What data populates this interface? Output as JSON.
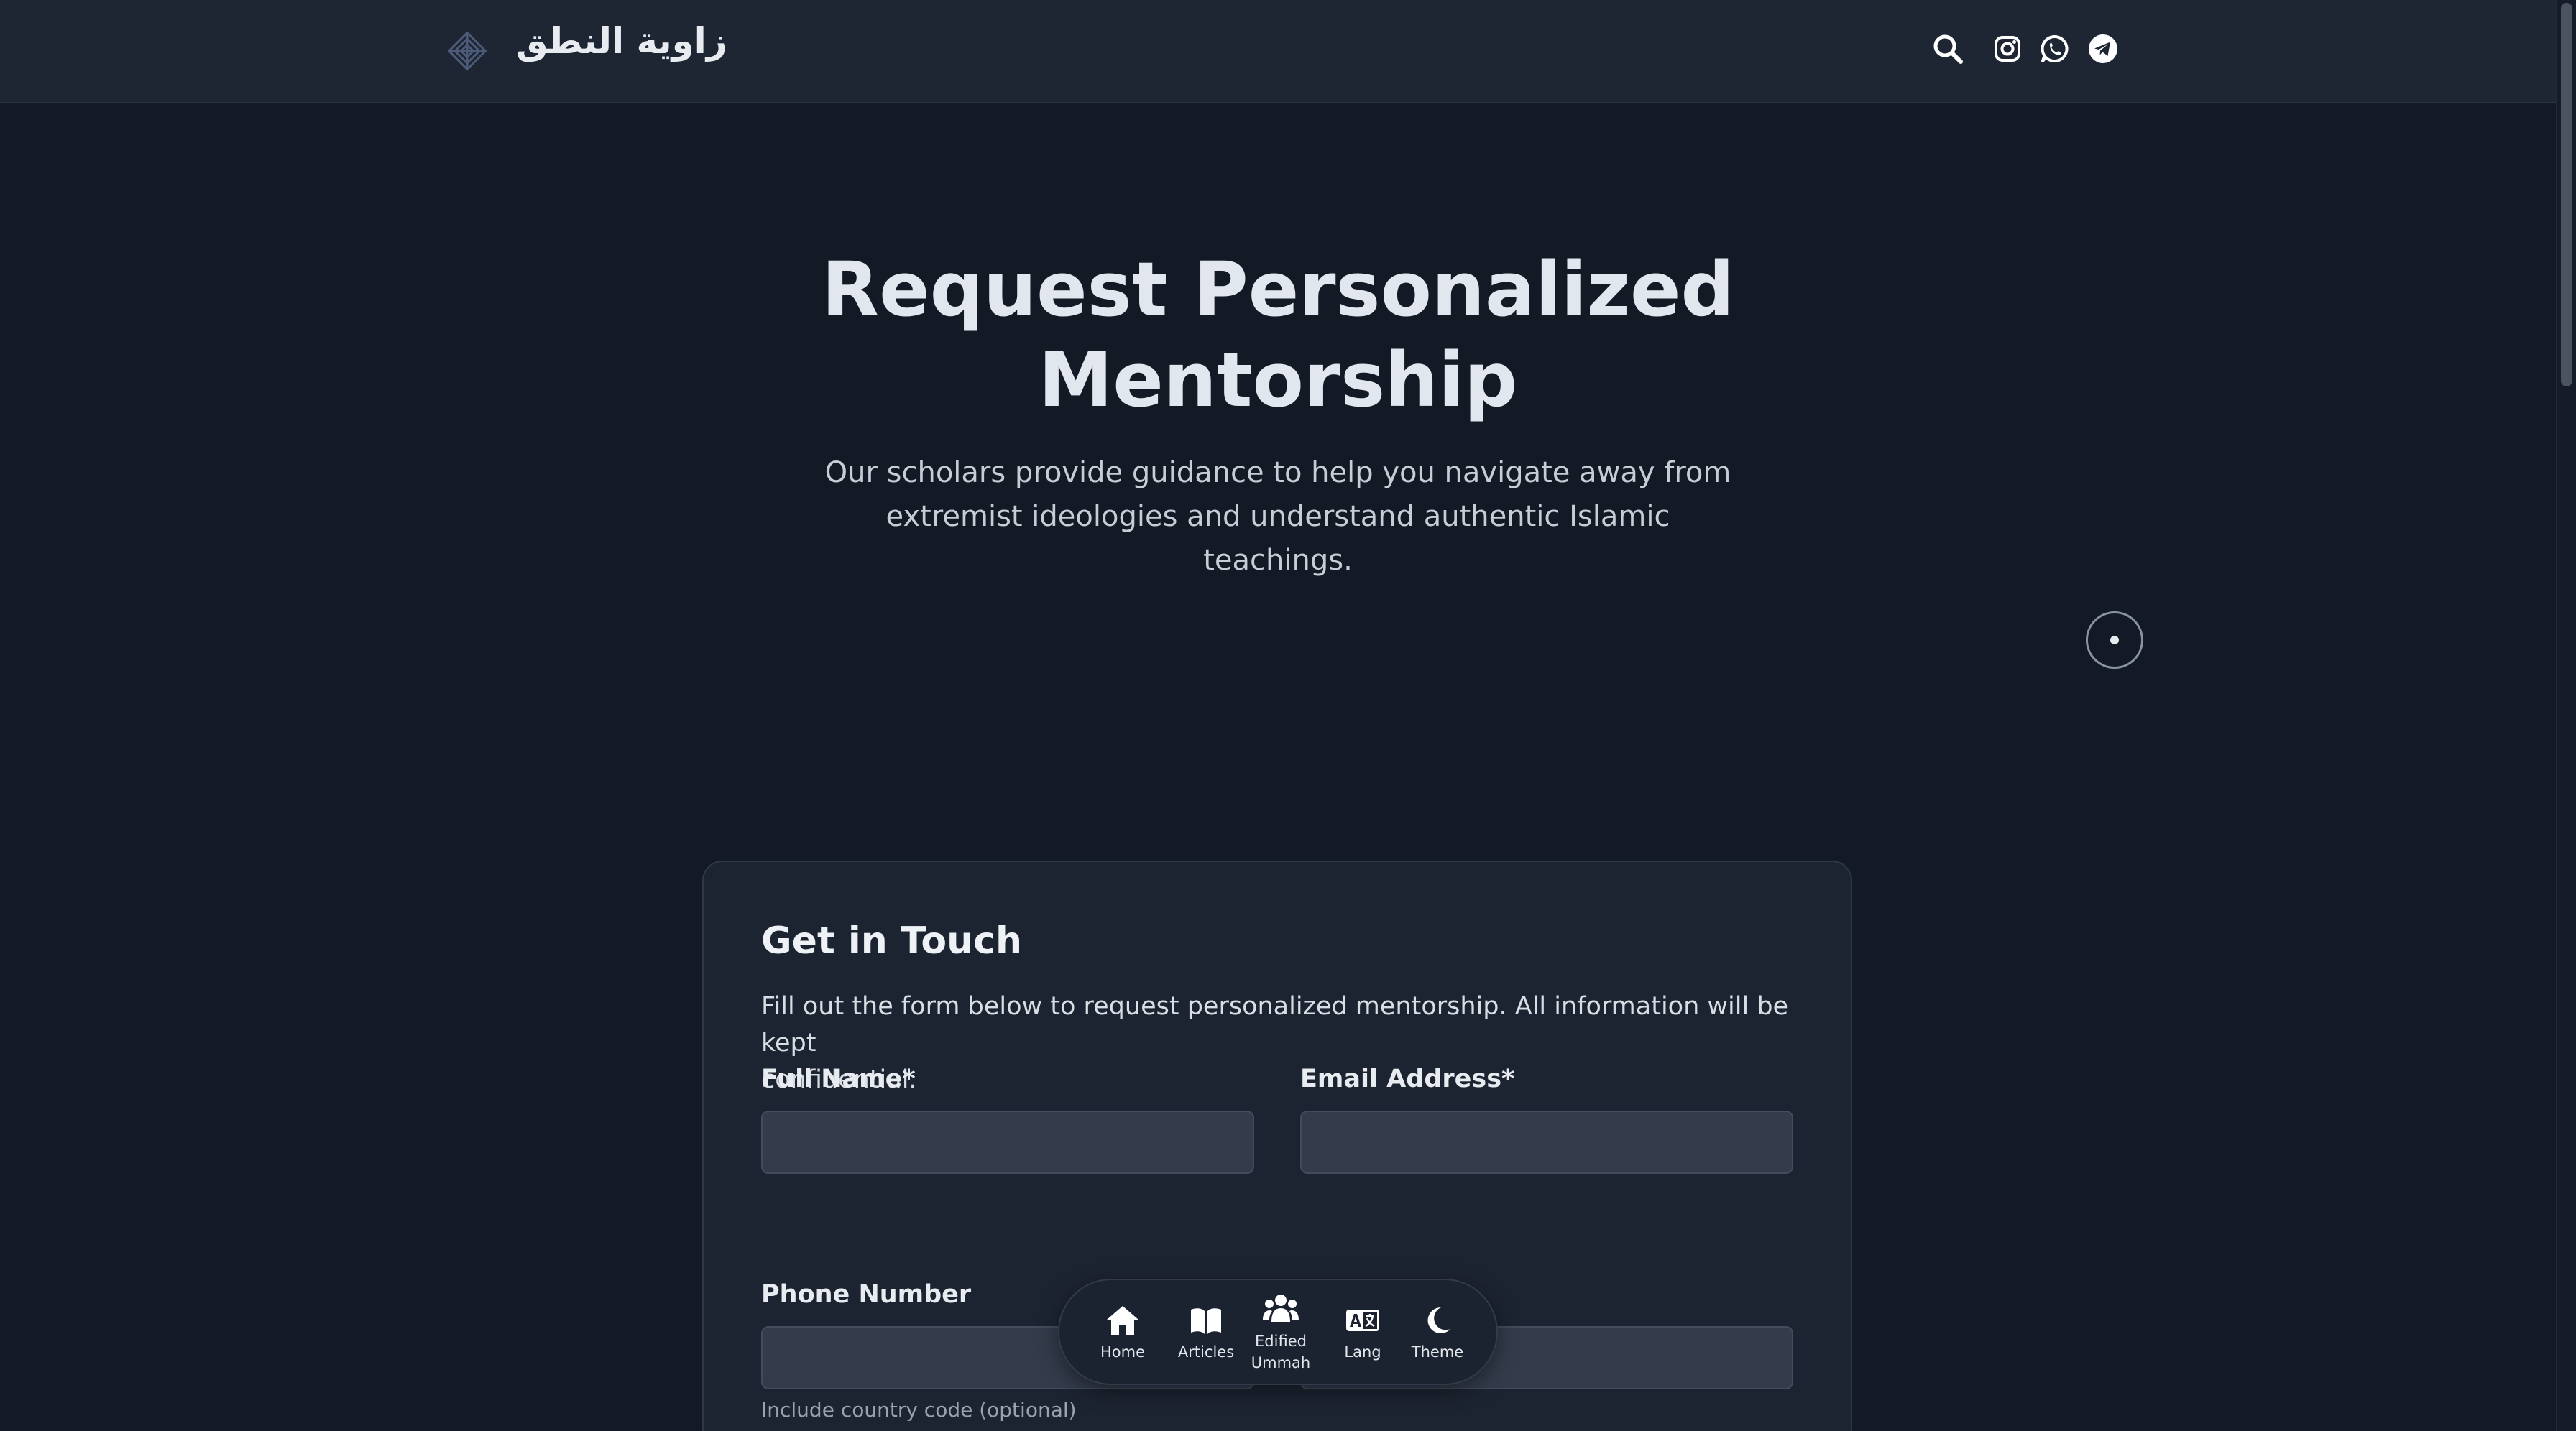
{
  "header": {
    "brand_name": "زاوية النطق",
    "icons": [
      "search-icon",
      "instagram-icon",
      "whatsapp-icon",
      "telegram-icon"
    ]
  },
  "hero": {
    "title_line1": "Request Personalized",
    "title_line2": "Mentorship",
    "subtitle_line1": "Our scholars provide guidance to help you navigate away from",
    "subtitle_line2": "extremist ideologies and understand authentic Islamic",
    "subtitle_line3": "teachings."
  },
  "form": {
    "title": "Get in Touch",
    "description_line1": "Fill out the form below to request personalized mentorship. All information will be kept",
    "description_line2": "confidential.",
    "full_name_label": "Full Name*",
    "full_name_value": "",
    "email_label": "Email Address*",
    "email_value": "",
    "phone_label": "Phone Number",
    "phone_value": "",
    "phone_help": "Include country code (optional)"
  },
  "bottom_nav": {
    "items": [
      {
        "label": "Home",
        "icon": "home-icon"
      },
      {
        "label": "Articles",
        "icon": "book-icon"
      },
      {
        "label": "Edified",
        "label2": "Ummah",
        "icon": "users-icon"
      },
      {
        "label": "Lang",
        "icon": "language-icon"
      },
      {
        "label": "Theme",
        "icon": "moon-icon"
      }
    ]
  },
  "colors": {
    "background": "#131a26",
    "header": "#1e2533",
    "card": "#1d2431",
    "input": "#343c4b"
  }
}
